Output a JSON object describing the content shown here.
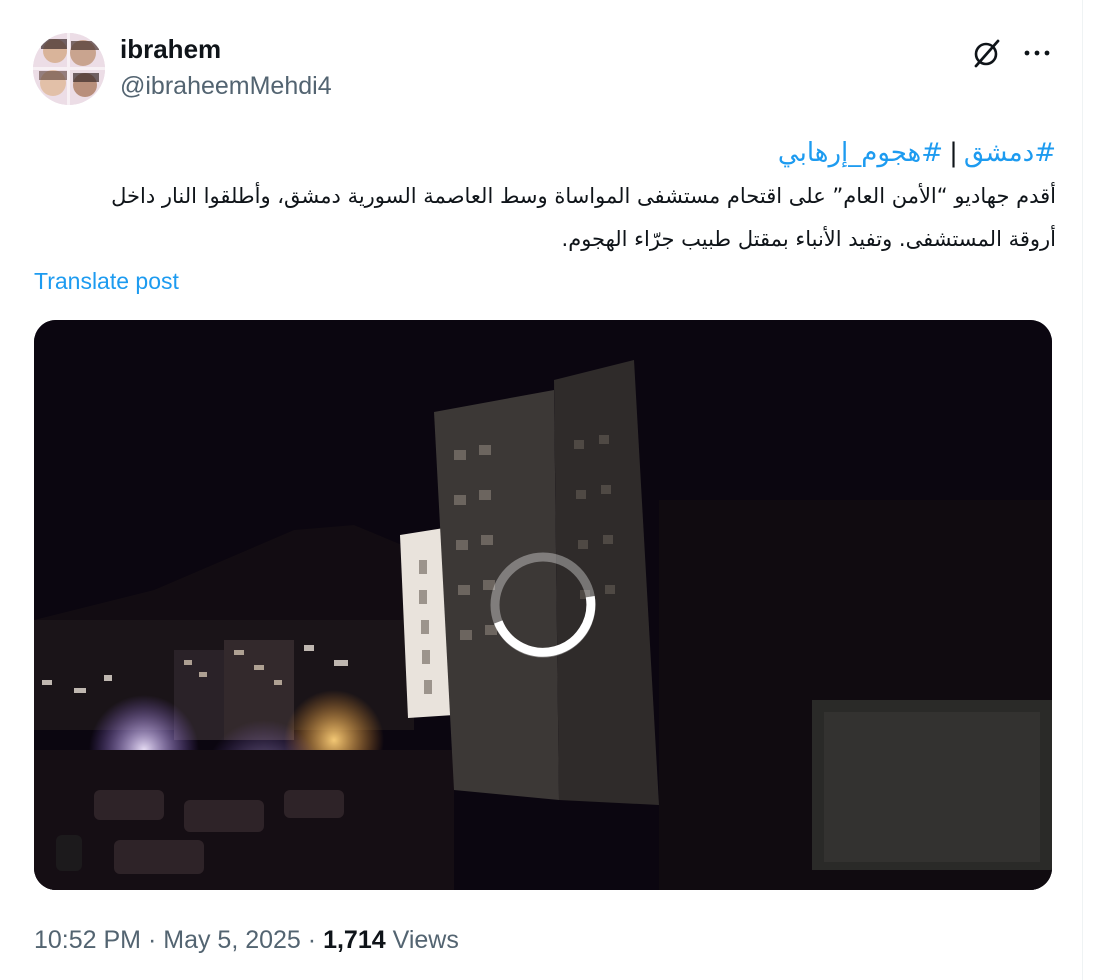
{
  "author": {
    "name": "ibrahem",
    "handle": "@ibraheemMehdi4"
  },
  "post": {
    "hashtags": [
      "#دمشق",
      "#هجوم_إرهابي"
    ],
    "separator": "|",
    "body_line1": "أقدم جهاديو “الأمن العام” على اقتحام مستشفى المواساة وسط العاصمة السورية دمشق، وأطلقوا النار داخل",
    "body_line2": "أروقة المستشفى. وتفيد الأنباء بمقتل طبيب جرّاء الهجوم."
  },
  "actions": {
    "translate_label": "Translate post",
    "grok_icon": "grok-icon",
    "more_icon": "more-icon"
  },
  "media": {
    "type": "video",
    "state": "loading"
  },
  "meta": {
    "time": "10:52 PM",
    "dot1": "·",
    "date": "May 5, 2025",
    "dot2": "·",
    "views_count": "1,714",
    "views_label": "Views"
  },
  "colors": {
    "link": "#1d9bf0",
    "secondary_text": "#536471",
    "primary_text": "#0f1419"
  }
}
